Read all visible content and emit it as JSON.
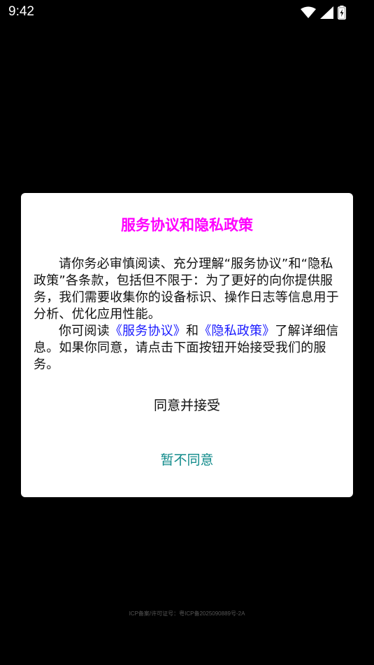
{
  "status_bar": {
    "time": "9:42",
    "icons": [
      "wifi-icon",
      "cellular-signal-icon",
      "battery-charging-icon"
    ]
  },
  "dialog": {
    "title": "服务协议和隐私政策",
    "paragraph1": "请你务必审慎阅读、充分理解“服务协议”和“隐私政策”各条款，包括但不限于：为了更好的向你提供服务，我们需要收集你的设备标识、操作日志等信息用于分析、优化应用性能。",
    "paragraph2_prefix": "你可阅读",
    "service_link": "《服务协议》",
    "paragraph2_and": "和",
    "privacy_link": "《隐私政策》",
    "paragraph2_suffix": "了解详细信息。如果你同意，请点击下面按钮开始接受我们的服务。",
    "accept_label": "同意并接受",
    "reject_label": "暂不同意"
  },
  "footer": {
    "icp": "ICP备案/许可证号：粤ICP备2025090889号-2A"
  },
  "colors": {
    "title": "#ff00ff",
    "link": "#1a1aff",
    "reject": "#0f8a8a",
    "background": "#000000",
    "dialog": "#ffffff"
  }
}
